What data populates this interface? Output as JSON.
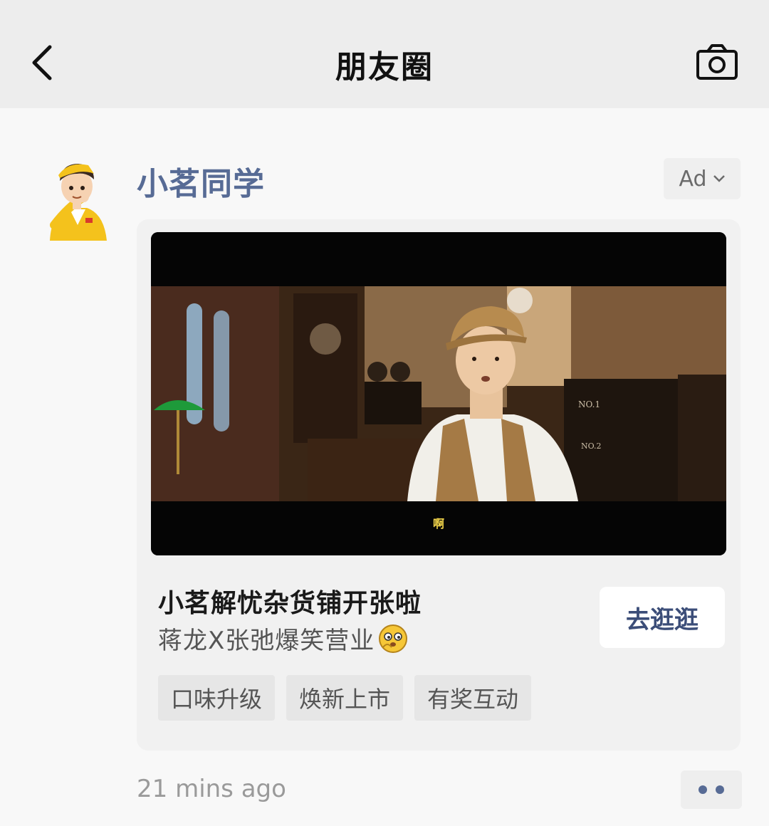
{
  "header": {
    "title": "朋友圈",
    "back_icon": "chevron-left-icon",
    "camera_icon": "camera-icon"
  },
  "post": {
    "username": "小茗同学",
    "ad_label": "Ad",
    "video_subtitle": "啊",
    "ad_title": "小茗解忧杂货铺开张啦",
    "ad_description": "蒋龙X张弛爆笑营业",
    "cta_label": "去逛逛",
    "tags": [
      "口味升级",
      "焕新上市",
      "有奖互动"
    ],
    "timestamp": "21 mins ago"
  },
  "colors": {
    "link_blue": "#576b95",
    "topbar_bg": "#ededed",
    "accent_yellow": "#f4c21c"
  }
}
